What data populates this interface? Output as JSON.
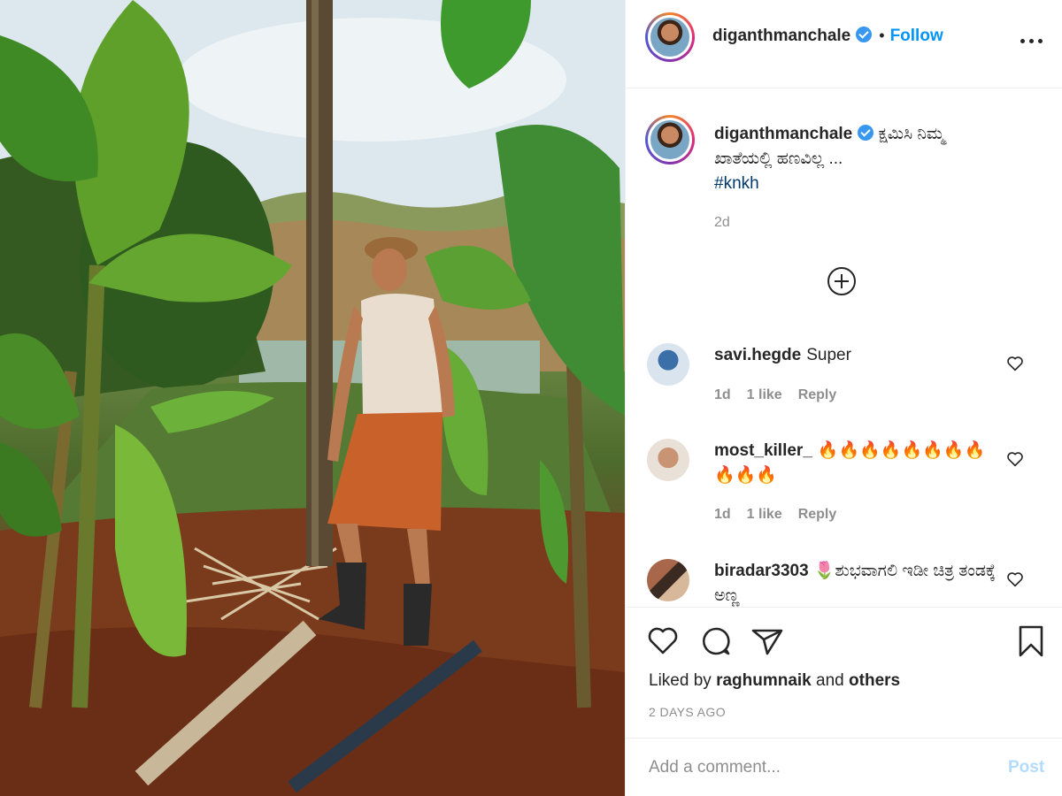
{
  "post": {
    "author": "diganthmanchale",
    "follow_label": "Follow",
    "dot": "•",
    "caption": "ಕ್ಷಮಿಸಿ ನಿಮ್ಮ ಖಾತೆಯಲ್ಲಿ ಹಣವಿಲ್ಲ ...",
    "hashtag": "#knkh",
    "caption_age": "2d"
  },
  "comments": [
    {
      "user": "savi.hegde",
      "text": "Super",
      "age": "1d",
      "likes": "1 like",
      "reply": "Reply"
    },
    {
      "user": "most_killer_",
      "text": "🔥🔥🔥🔥🔥🔥🔥🔥🔥🔥🔥",
      "age": "1d",
      "likes": "1 like",
      "reply": "Reply"
    },
    {
      "user": "biradar3303",
      "text": "🌷ಶುಭವಾಗಲಿ ಇಡೀ ಚಿತ್ರ ತಂಡಕ್ಕೆ ಅಣ್ಣ",
      "age": "",
      "likes": "",
      "reply": ""
    }
  ],
  "footer": {
    "liked_prefix": "Liked by",
    "liked_user": "raghumnaik",
    "liked_and": "and",
    "liked_others": "others",
    "time": "2 DAYS AGO",
    "comment_placeholder": "Add a comment...",
    "post_label": "Post"
  },
  "icons": {
    "verified": "verified-badge-icon",
    "more": "more-options-icon",
    "load_more": "plus-circle-icon",
    "like": "heart-icon",
    "comment": "comment-bubble-icon",
    "share": "paper-plane-icon",
    "save": "bookmark-icon"
  },
  "colors": {
    "link_blue": "#0095f6",
    "verified_blue": "#3897f0",
    "hashtag": "#00376b",
    "muted": "#8e8e8e",
    "post_disabled": "#b3dbff"
  }
}
